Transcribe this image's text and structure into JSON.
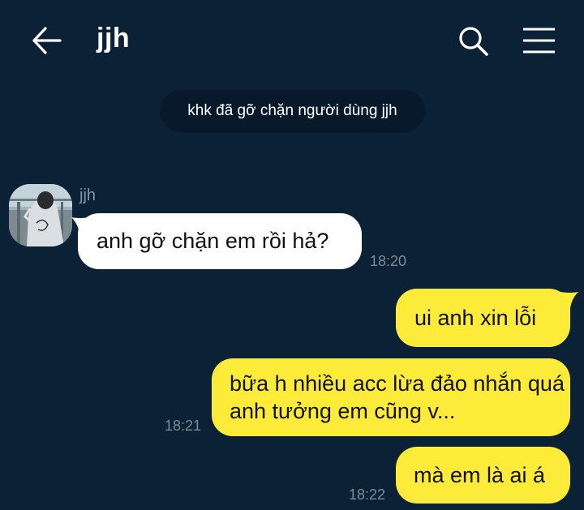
{
  "header": {
    "title": "jjh",
    "back_icon": "arrow-left-icon",
    "search_icon": "search-icon",
    "menu_icon": "hamburger-menu-icon"
  },
  "system_notice": "khk đã gỡ chặn người dùng jjh",
  "messages": [
    {
      "direction": "in",
      "sender": "jjh",
      "text": "anh gỡ chặn em rồi hả?",
      "time": "18:20"
    },
    {
      "direction": "out",
      "text": "ui anh xin lỗi",
      "time": ""
    },
    {
      "direction": "out",
      "text": "bữa h nhiều acc lừa đảo nhắn quá anh tưởng em cũng v...",
      "time": "18:21"
    },
    {
      "direction": "out",
      "text": "mà em là ai á",
      "time": "18:22"
    }
  ],
  "colors": {
    "background": "#0b2236",
    "incoming_bubble": "#ffffff",
    "outgoing_bubble": "#fdeb39",
    "notice_bg": "#07192a"
  }
}
